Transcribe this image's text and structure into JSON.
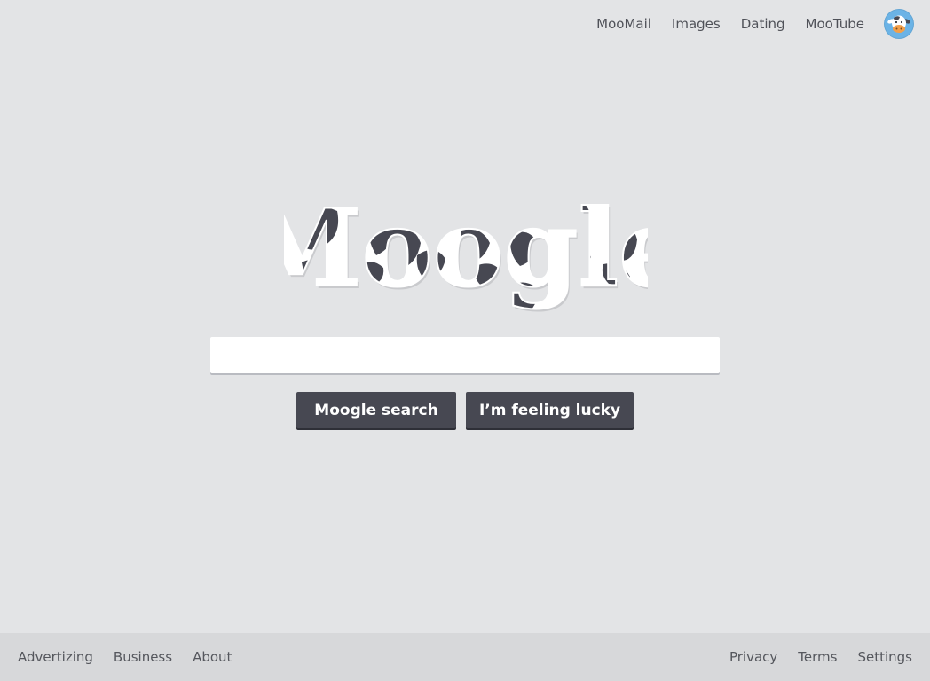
{
  "nav": {
    "links": [
      "MooMail",
      "Images",
      "Dating",
      "MooTube"
    ],
    "avatar_icon": "cow-avatar-icon"
  },
  "logo": {
    "text": "Moogle"
  },
  "search": {
    "value": "",
    "placeholder": ""
  },
  "buttons": {
    "search_label": "Moogle search",
    "lucky_label": "I’m feeling lucky"
  },
  "footer": {
    "left": [
      "Advertizing",
      "Business",
      "About"
    ],
    "right": [
      "Privacy",
      "Terms",
      "Settings"
    ]
  },
  "colors": {
    "background": "#e3e4e6",
    "button": "#474852",
    "footer": "#d7d8da",
    "cow_spots": "#474852",
    "avatar": "#6bb3e6"
  }
}
